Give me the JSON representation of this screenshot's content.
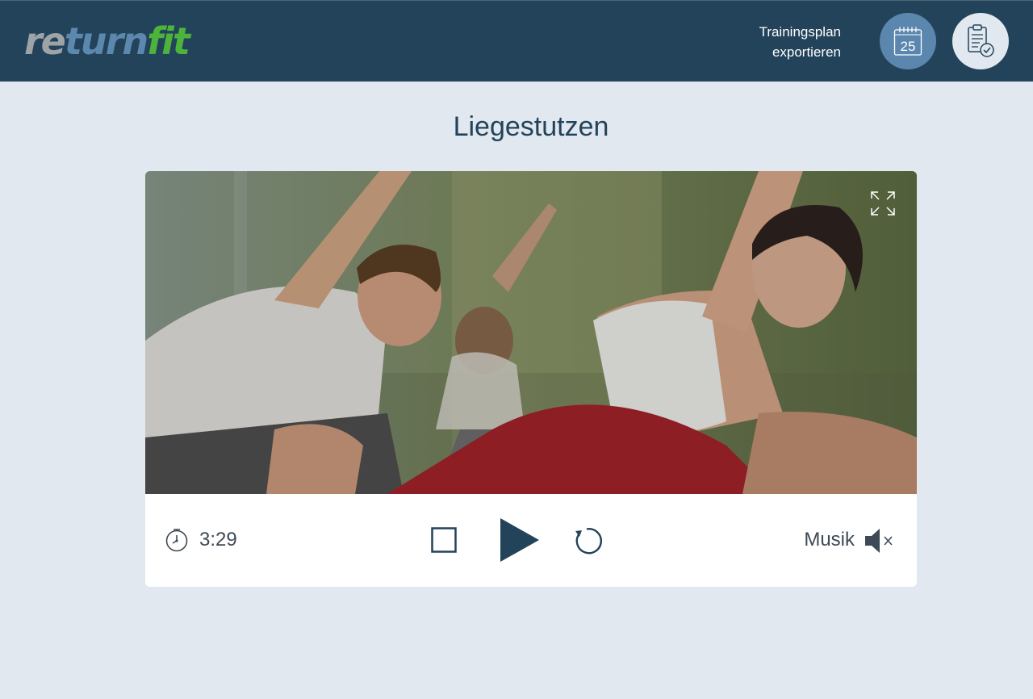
{
  "app": {
    "logo": {
      "part1": "re",
      "part2": "turn",
      "part3": "fit"
    },
    "colors": {
      "header_bg": "#23435b",
      "page_bg": "#e1e8ef",
      "accent_blue": "#5b87ae",
      "logo_gray": "#9ea3a8",
      "logo_blue": "#5c88ad",
      "logo_green": "#4db33b"
    }
  },
  "header": {
    "export_line1": "Trainingsplan",
    "export_line2": "exportieren",
    "calendar_day": "25",
    "calendar_icon": "calendar-icon",
    "clipboard_icon": "clipboard-check-icon"
  },
  "exercise": {
    "title": "Liegestutzen"
  },
  "player": {
    "time": "3:29",
    "music_label": "Musik",
    "icons": {
      "fullscreen": "expand-icon",
      "timer": "stopwatch-icon",
      "stop": "stop-icon",
      "play": "play-icon",
      "replay": "replay-icon",
      "mute": "speaker-muted-icon"
    }
  }
}
